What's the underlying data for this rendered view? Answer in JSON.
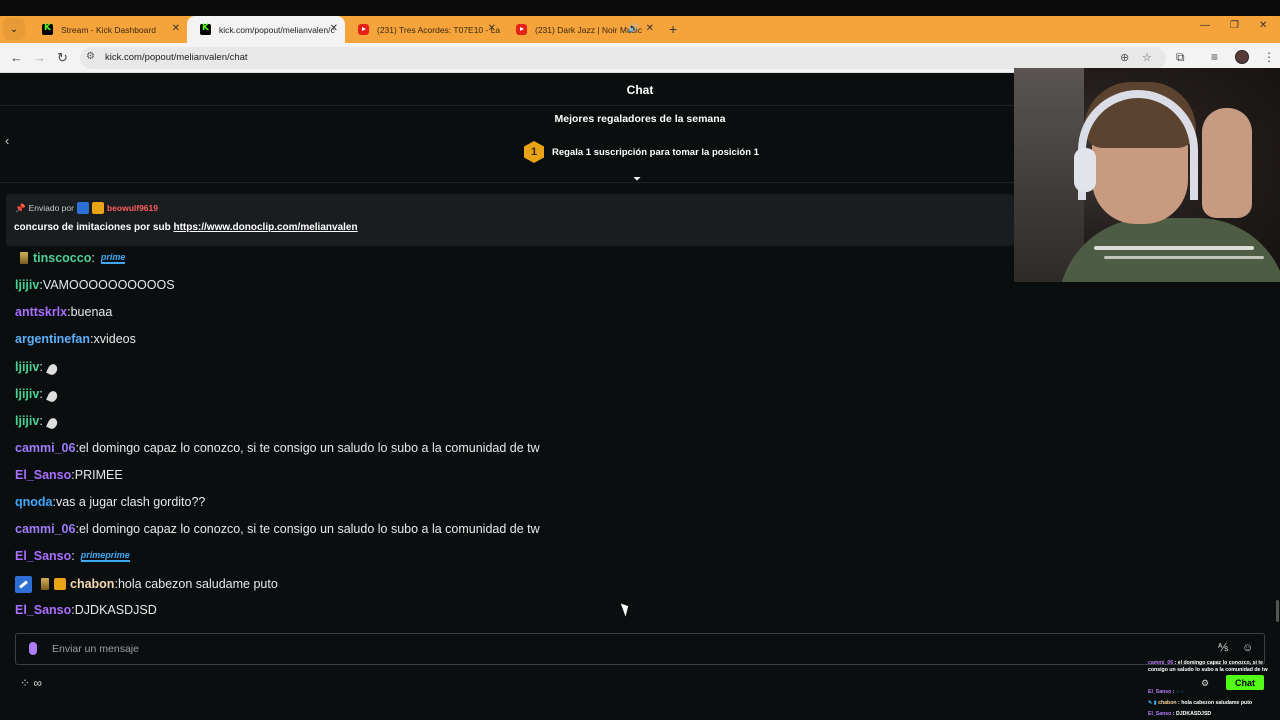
{
  "browser": {
    "tabs": [
      {
        "title": "Stream - Kick Dashboard",
        "icon": "kick",
        "active": false
      },
      {
        "title": "kick.com/popout/melianvalen/c",
        "icon": "kick",
        "active": true
      },
      {
        "title": "(231) Tres Acordes: T07E10 - La",
        "icon": "youtube",
        "active": false
      },
      {
        "title": "(231) Dark Jazz | Noir Music",
        "icon": "youtube",
        "active": false,
        "audio": true
      }
    ],
    "url": "kick.com/popout/melianvalen/chat",
    "tab_bar_color": "#f5a33b"
  },
  "chat": {
    "title": "Chat",
    "leaderboard_title": "Mejores regaladores de la semana",
    "rank_badge": "1",
    "gift_prompt": "Regala 1 suscripción para tomar la posición 1",
    "pinned": {
      "sent_by_label": "Enviado por",
      "user": "beowulf9619",
      "message_prefix": "concurso de imitaciones por sub ",
      "link": "https://www.donoclip.com/melianvalen"
    },
    "messages": [
      {
        "user": "tinscocco",
        "text": "",
        "emote": "prime"
      },
      {
        "user": "ljijiv",
        "text": "VAMOOOOOOOOOOS"
      },
      {
        "user": "anttskrlx",
        "text": "buenaa"
      },
      {
        "user": "argentinefan",
        "text": "xvideos"
      },
      {
        "user": "ljijiv",
        "text": "",
        "emote": "feather"
      },
      {
        "user": "ljijiv",
        "text": "",
        "emote": "feather"
      },
      {
        "user": "ljijiv",
        "text": "",
        "emote": "feather"
      },
      {
        "user": "cammi_06",
        "text": "el domingo capaz lo conozco, si te consigo un saludo lo subo a la comunidad de tw"
      },
      {
        "user": "El_Sanso",
        "text": "PRIMEE"
      },
      {
        "user": "qnoda",
        "text": "vas a jugar clash gordito??"
      },
      {
        "user": "cammi_06",
        "text": "el domingo capaz lo conozco, si te consigo un saludo lo subo a la comunidad de tw"
      },
      {
        "user": "El_Sanso",
        "text": "",
        "emote": "primeprime"
      },
      {
        "user": "chabon",
        "text": "hola cabezon saludame puto"
      },
      {
        "user": "El_Sanso",
        "text": "DJDKASDJSD"
      }
    ],
    "emotes": {
      "prime": "prime",
      "primeprime": "primeprime"
    },
    "separator": ": ",
    "input_placeholder": "Enviar un mensaje",
    "footer_infinity": "∞"
  },
  "overlay": {
    "mini_lines": [
      {
        "user": "cammi_06",
        "text": "el domingo capaz lo conozco, si te consigo un saludo lo subo a la comunidad de tw"
      },
      {
        "user": "El_Sanso",
        "text": ""
      },
      {
        "user": "chabon",
        "text": "hola cabezon saludame puto"
      },
      {
        "user": "El_Sanso",
        "text": "DJDKASDJSD"
      }
    ],
    "chat_button": "Chat",
    "accent": "#53fc18"
  }
}
